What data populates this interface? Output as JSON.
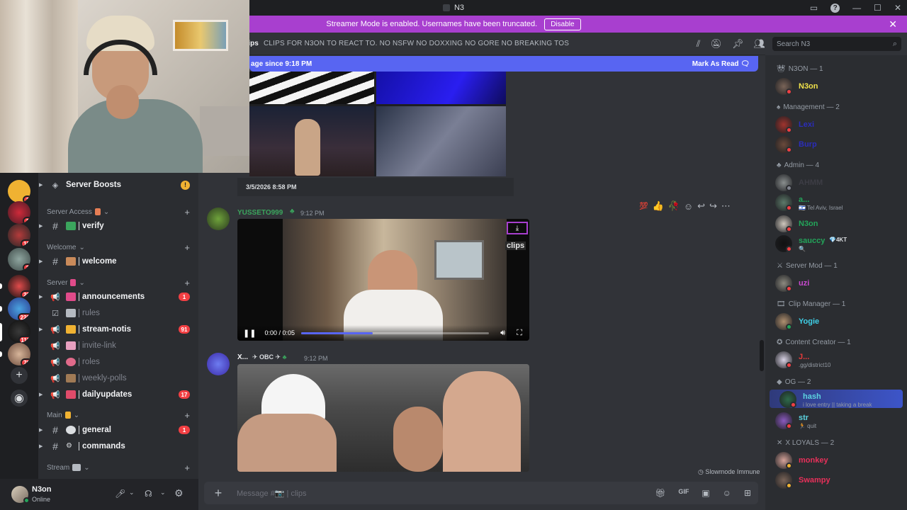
{
  "window": {
    "title": "N3"
  },
  "banner": {
    "text": "Streamer Mode is enabled. Usernames have been truncated.",
    "disable_label": "Disable"
  },
  "topbar": {
    "channel_name": "clips",
    "topic": "CLIPS FOR N3ON TO REACT TO. NO NSFW NO DOXXING NO GORE NO BREAKING TOS",
    "search_placeholder": "Search N3"
  },
  "new_messages": {
    "text": "age since 9:18 PM",
    "mark_label": "Mark As Read"
  },
  "servers": [
    {
      "badge": "1"
    },
    {
      "badge": "1"
    },
    {
      "badge": "10"
    },
    {
      "badge": "3"
    },
    {
      "badge": "21"
    },
    {
      "badge": "222"
    },
    {
      "badge": "111"
    },
    {
      "badge": "76"
    }
  ],
  "sidebar": {
    "boosts_label": "Server Boosts",
    "categories": [
      {
        "label": "Server Access"
      },
      {
        "label": "Welcome"
      },
      {
        "label": "Server"
      },
      {
        "label": "Main"
      },
      {
        "label": "Stream"
      }
    ],
    "channels": [
      {
        "name": "verify",
        "unread": true
      },
      {
        "name": "welcome",
        "unread": true
      },
      {
        "name": "announcements",
        "unread": true,
        "mentions": "1"
      },
      {
        "name": "rules",
        "unread": false
      },
      {
        "name": "stream-notis",
        "unread": true,
        "mentions": "91"
      },
      {
        "name": "invite-link",
        "unread": false
      },
      {
        "name": "roles",
        "unread": false
      },
      {
        "name": "weekly-polls",
        "unread": false
      },
      {
        "name": "dailyupdates",
        "unread": true,
        "mentions": "17"
      },
      {
        "name": "general",
        "unread": true,
        "mentions": "1"
      },
      {
        "name": "commands",
        "unread": true
      }
    ]
  },
  "user": {
    "name": "N3on",
    "status": "Online"
  },
  "messages": [
    {
      "timestamp": "3/5/2026 8:58 PM"
    },
    {
      "author": "YUSSETO999",
      "time": "9:12 PM",
      "author_color": "#3ba55d",
      "video_time": "0:00 / 0:05",
      "video_progress": 0.38,
      "video_overlay": "clips"
    },
    {
      "author": "X...",
      "badge": "OBC",
      "time": "9:12 PM",
      "author_color": "#f2f3f5"
    }
  ],
  "slowmode_text": "Slowmode Immune",
  "composer": {
    "placeholder": "Message #📷 | clips"
  },
  "members": {
    "groups": [
      {
        "label": "N3ON — 1",
        "members": [
          {
            "name": "N3on",
            "color": "#f0e14a",
            "status": "#f23f43"
          }
        ]
      },
      {
        "label": "Management — 2",
        "members": [
          {
            "name": "Lexi",
            "color": "#2b2dba",
            "status": "#f23f43"
          },
          {
            "name": "Burp",
            "color": "#2b2dba",
            "status": "#f23f43"
          }
        ]
      },
      {
        "label": "Admin — 4",
        "members": [
          {
            "name": "AHMM",
            "color": "#3d3d45",
            "status": "#80848e"
          },
          {
            "name": "a...",
            "color": "#23a55a",
            "status": "#f23f43",
            "sub": "🇮🇱 Tel Aviv, Israel"
          },
          {
            "name": "N3on",
            "color": "#23a55a",
            "status": "#f23f43"
          },
          {
            "name": "sauccy",
            "color": "#23a55a",
            "status": "#f23f43",
            "tag": "💎4KT",
            "sub": "🔍"
          }
        ]
      },
      {
        "label": "Server Mod — 1",
        "members": [
          {
            "name": "uzi",
            "color": "#c94ad1",
            "status": "#f23f43"
          }
        ]
      },
      {
        "label": "Clip Manager — 1",
        "members": [
          {
            "name": "Yogie",
            "color": "#3fd0e8",
            "status": "#23a55a"
          }
        ]
      },
      {
        "label": "Content Creator — 1",
        "members": [
          {
            "name": "J...",
            "color": "#e83b3b",
            "status": "#f23f43",
            "sub": ".gg/district10"
          }
        ]
      },
      {
        "label": "OG — 2",
        "members": [
          {
            "name": "hash",
            "color": "#5cd3e0",
            "status": "#f23f43",
            "sub": "i love entry || taking a break"
          },
          {
            "name": "str",
            "color": "#5cd3e0",
            "status": "#f23f43",
            "sub": "🏃 quit"
          }
        ]
      },
      {
        "label": "X LOYALS — 2",
        "members": [
          {
            "name": "monkey",
            "color": "#e8305a",
            "status": "#f0b232"
          },
          {
            "name": "Swampy",
            "color": "#e8305a",
            "status": "#f0b232"
          }
        ]
      }
    ]
  }
}
